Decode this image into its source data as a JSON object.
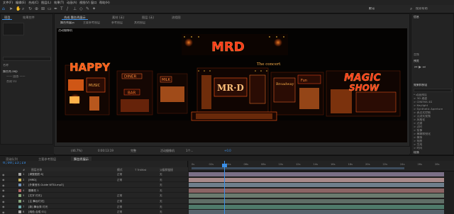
{
  "menu": [
    "文件(F)",
    "编辑(E)",
    "合成(C)",
    "图层(L)",
    "效果(T)",
    "动画(A)",
    "视图(V)",
    "窗口",
    "帮助(H)"
  ],
  "toolbar": {
    "tools": [
      {
        "name": "home-icon",
        "glyph": "⌂"
      },
      {
        "name": "selection-tool-icon",
        "glyph": "➤"
      },
      {
        "name": "hand-tool-icon",
        "glyph": "✋"
      },
      {
        "name": "zoom-tool-icon",
        "glyph": "⌕"
      },
      {
        "name": "rotate-tool-icon",
        "glyph": "↻"
      },
      {
        "name": "camera-tool-icon",
        "glyph": "⊕"
      },
      {
        "name": "anchor-tool-icon",
        "glyph": "⊞"
      },
      {
        "name": "rectangle-tool-icon",
        "glyph": "▭"
      },
      {
        "name": "pen-tool-icon",
        "glyph": "✒"
      },
      {
        "name": "text-tool-icon",
        "glyph": "T"
      },
      {
        "name": "brush-tool-icon",
        "glyph": "/"
      },
      {
        "name": "stamp-tool-icon",
        "glyph": "⊥"
      },
      {
        "name": "eraser-tool-icon",
        "glyph": "◇"
      },
      {
        "name": "roto-tool-icon",
        "glyph": "✎"
      },
      {
        "name": "puppet-tool-icon",
        "glyph": "✦"
      }
    ],
    "workspace_label": "默认",
    "search_label": "搜索帮助"
  },
  "project_panel": {
    "tabs": [
      "项目",
      "效果控件"
    ],
    "section_label": "名称",
    "items": [
      "舞台秀.aep",
      "—— 固态 ——",
      "合成 01"
    ]
  },
  "viewer": {
    "tabs": [
      "合成 舞台秀展示",
      "素材 (无)",
      "图层 (无)",
      "流程图"
    ],
    "breadcrumb": [
      "舞台秀展示",
      "主要参考图层",
      "参考图层",
      "其他图层"
    ],
    "comp_label": "活动摄像机",
    "scene_text": {
      "happy": "HAPPY",
      "mrd_top": "MRD",
      "mrd_mid": "MR·D",
      "magic": "MAGIC",
      "show": "SHOW",
      "music": "MUSIC",
      "bar": "BAR",
      "diner": "DINER",
      "concert": "The concert",
      "broadway": "Broadway",
      "milk": "MILK",
      "fun": "Fun"
    }
  },
  "viewer_controls": {
    "zoom": "(46.7%)",
    "timecode": "0:00:13:19",
    "resolution": "完整",
    "camera": "活动摄像机",
    "views": "1个...",
    "exposure": "+0.0"
  },
  "right_panel": {
    "sections": [
      "信息",
      "音频",
      "预览",
      "效果和预设"
    ],
    "search_placeholder": "搜索",
    "items": [
      "* 动画预设",
      "> 3D 通道",
      "> CINEMA 4D",
      "> Keylight",
      "> Synthetic Aperture",
      "> 表达式控制",
      "> 沉浸式视频",
      "> 风格化",
      "> 过渡",
      "> 过时",
      "> 抠像",
      "> 模糊和锐化",
      "> 模拟",
      "> 扭曲",
      "> 生成",
      "> 时间",
      "> 实用工具",
      "> 通道",
      "> 透视",
      "> 文本",
      "> 颜色校正",
      "> 音频",
      "> 杂色和颗粒",
      "> 遮罩"
    ],
    "bottom": [
      "段落",
      "字符"
    ]
  },
  "timeline": {
    "tabs": [
      "渲染队列",
      "主要参考图层",
      "舞台秀展示"
    ],
    "timecode": "0;00;13;19",
    "columns": [
      "#",
      "图层名称",
      "模式",
      "T TrkMat",
      "父级和链接"
    ],
    "ruler": [
      "0s",
      "02s",
      "04s",
      "06s",
      "08s",
      "10s",
      "12s",
      "14s",
      "16s",
      "18s",
      "20s",
      "22s",
      "24s",
      "26s",
      "28s"
    ],
    "layers": [
      {
        "num": "1",
        "name": "[调整图层 8]",
        "mode": "正常",
        "parent": "无",
        "color": "#a4a4a4",
        "bar": "#7a6f86"
      },
      {
        "num": "2",
        "name": "[MRD]",
        "mode": "正常",
        "parent": "无",
        "color": "#c9b55a",
        "bar": "#a88a8a"
      },
      {
        "num": "3",
        "name": "[外景音乐.Guide WTIA.mp3]",
        "mode": "",
        "parent": "无",
        "color": "#6e8fb4",
        "bar": "#6f7f8c"
      },
      {
        "num": "4",
        "name": "摄像机 1",
        "mode": "",
        "parent": "无",
        "color": "#b76666",
        "bar": "#8a6464"
      },
      {
        "num": "5",
        "name": "[文字 灯光]",
        "mode": "正常",
        "parent": "无",
        "color": "#86a57a",
        "bar": "#6a7a6e"
      },
      {
        "num": "6",
        "name": "[主 舞台灯光]",
        "mode": "正常",
        "parent": "无",
        "color": "#86a57a",
        "bar": "#5f6e66"
      },
      {
        "num": "7",
        "name": "[新] 舞台秀 灯光",
        "mode": "正常",
        "parent": "无",
        "color": "#6ea7a7",
        "bar": "#4f7a6a"
      },
      {
        "num": "8",
        "name": "[纯色 合成 01]",
        "mode": "正常",
        "parent": "无",
        "color": "#a4a4a4",
        "bar": "#56636b"
      }
    ]
  },
  "colors": {
    "accent": "#3a8fe8",
    "neon_orange": "#ff6a1a",
    "neon_red": "#ff2a1a",
    "neon_yellow": "#ffc23a"
  }
}
